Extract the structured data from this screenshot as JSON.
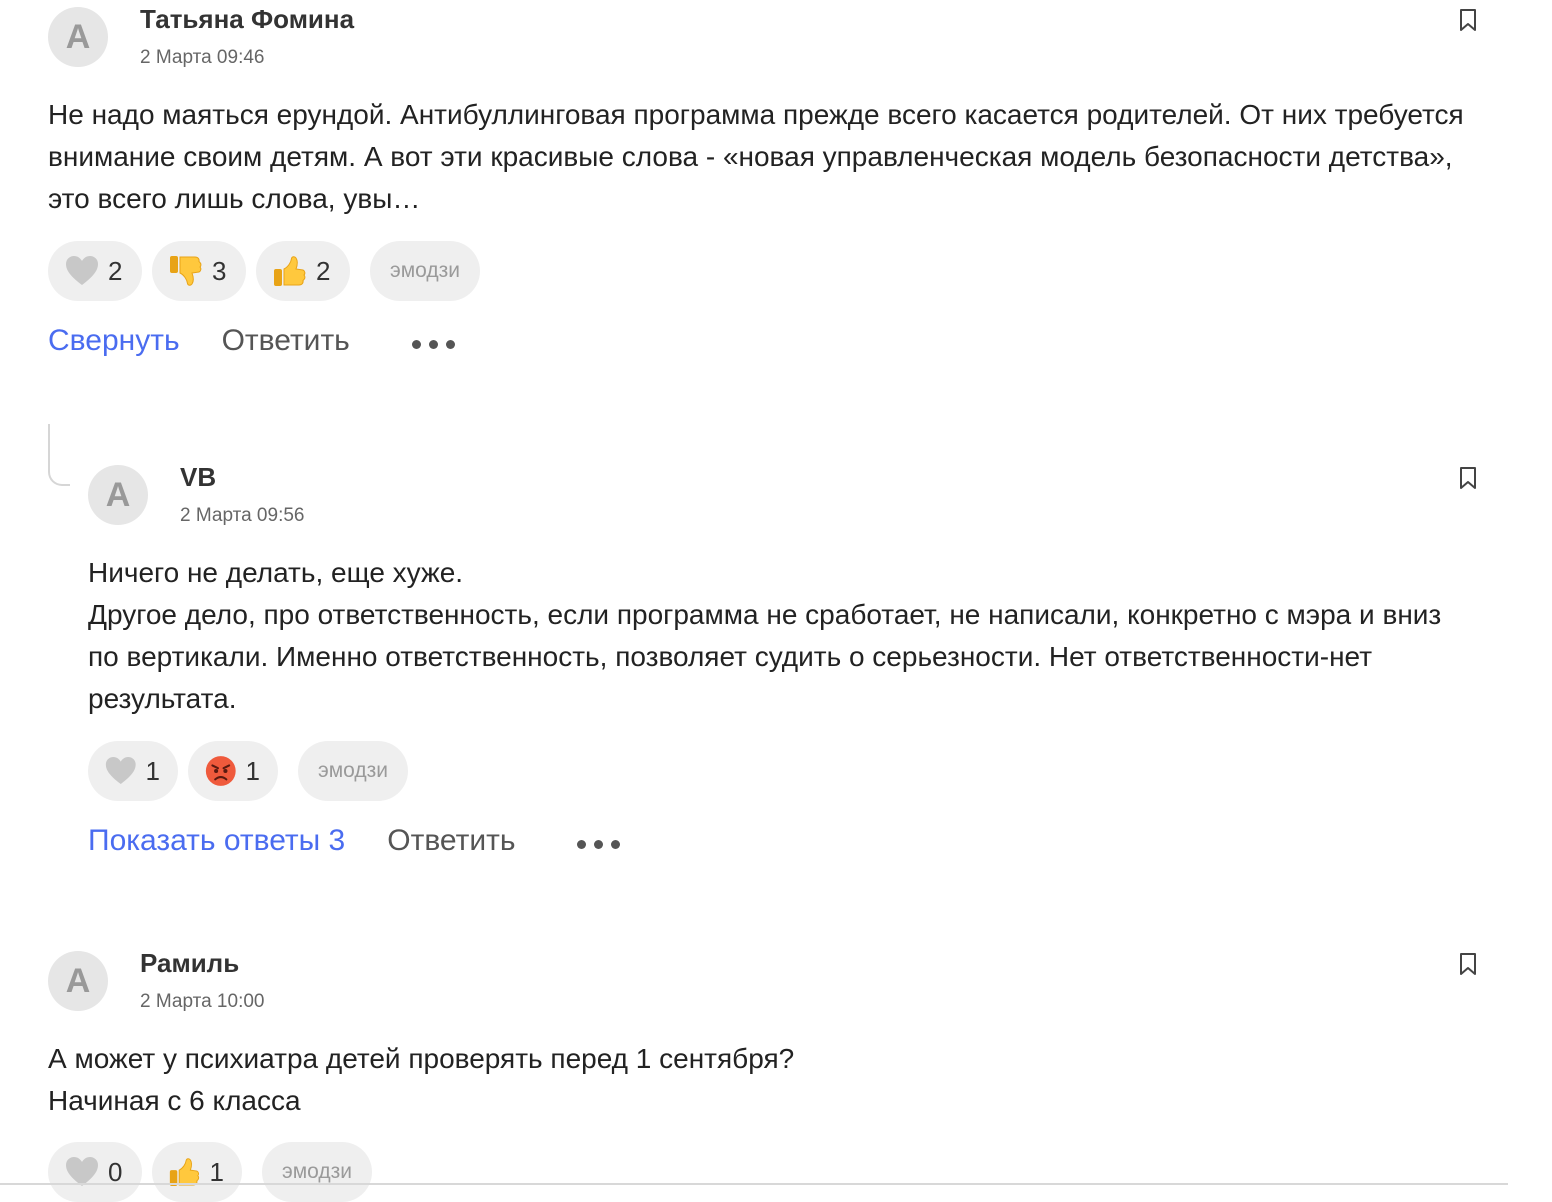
{
  "comments": [
    {
      "avatar_letter": "A",
      "author": "Татьяна Фомина",
      "date": "2 Марта 09:46",
      "text": [
        "Не надо маяться ерундой. Антибуллинговая программа прежде всего касается родителей. От них требуется внимание своим детям. А вот эти красивые слова - «новая управленческая модель безопасности детства», это всего лишь слова, увы…"
      ],
      "reactions": [
        {
          "icon": "heart-icon",
          "count": "2"
        },
        {
          "icon": "thumbs-down-icon",
          "count": "3"
        },
        {
          "icon": "thumbs-up-icon",
          "count": "2"
        }
      ],
      "emoji_label": "эмодзи",
      "toggle_label": "Свернуть",
      "reply_label": "Ответить"
    },
    {
      "avatar_letter": "A",
      "author": "VB",
      "date": "2 Марта 09:56",
      "text": [
        "Ничего не делать, еще хуже.",
        "Другое дело, про ответственность, если программа не сработает, не написали, конкретно с мэра и вниз по вертикали. Именно ответственность, позволяет судить о серьезности. Нет ответственности-нет результата."
      ],
      "reactions": [
        {
          "icon": "heart-icon",
          "count": "1"
        },
        {
          "icon": "angry-face-icon",
          "count": "1"
        }
      ],
      "emoji_label": "эмодзи",
      "toggle_label": "Показать ответы 3",
      "reply_label": "Ответить"
    },
    {
      "avatar_letter": "A",
      "author": "Рамиль",
      "date": "2 Марта 10:00",
      "text": [
        "А может у психиатра детей проверять перед 1 сентября?",
        "Начиная с 6 класса"
      ],
      "reactions": [
        {
          "icon": "heart-icon",
          "count": "0"
        },
        {
          "icon": "thumbs-up-icon",
          "count": "1"
        }
      ],
      "emoji_label": "эмодзи"
    }
  ],
  "colors": {
    "link": "#4a6cf0",
    "pill": "#efefef",
    "avatar_bg": "#e6e6e6"
  }
}
